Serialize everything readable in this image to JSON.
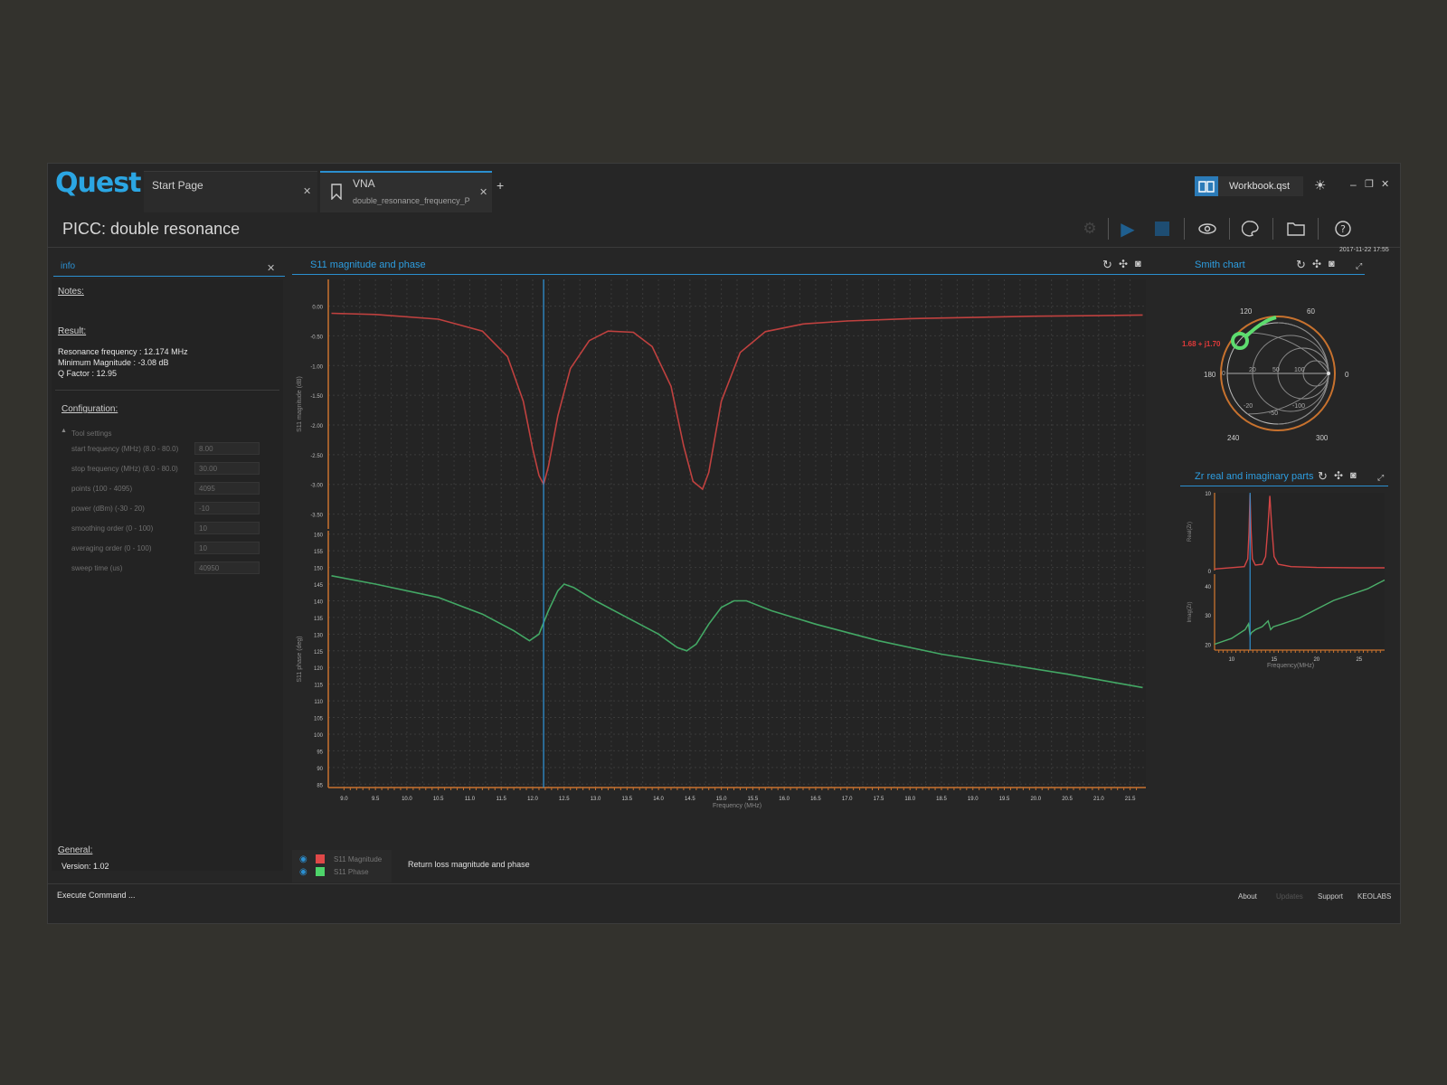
{
  "app": {
    "logo": "Quest"
  },
  "tabs": [
    {
      "label": "Start Page",
      "sub": ""
    },
    {
      "label": "VNA",
      "sub": "double_resonance_frequency_PI"
    }
  ],
  "tab_add": "+",
  "workbook": {
    "label": "Workbook.qst"
  },
  "page_title": "PICC: double resonance",
  "timestamp": "2017-11-22 17:55",
  "info_panel": {
    "search_value": "info",
    "notes_label": "Notes:",
    "result_label": "Result:",
    "result_lines": [
      "Resonance frequency : 12.174 MHz",
      "Minimum Magnitude : -3.08 dB",
      "Q Factor : 12.95"
    ],
    "config_label": "Configuration:",
    "tool_settings_label": "Tool settings",
    "settings": [
      {
        "label": "start frequency (MHz) (8.0 - 80.0)",
        "value": "8.00"
      },
      {
        "label": "stop frequency (MHz) (8.0 - 80.0)",
        "value": "30.00"
      },
      {
        "label": "points (100 - 4095)",
        "value": "4095"
      },
      {
        "label": "power (dBm) (-30 - 20)",
        "value": "-10"
      },
      {
        "label": "smoothing order (0 - 100)",
        "value": "10"
      },
      {
        "label": "averaging order (0 - 100)",
        "value": "10"
      },
      {
        "label": "sweep time (us)",
        "value": "40950"
      }
    ],
    "general_label": "General:",
    "version": "Version: 1.02"
  },
  "main_chart_title": "S11 magnitude and phase",
  "smith_title": "Smith chart",
  "smith_readout": "1.68 + j1.70",
  "smith_labels": [
    "120",
    "60",
    "180",
    "0",
    "240",
    "300",
    "20",
    "50",
    "100",
    "-20",
    "-50",
    "-100",
    "0"
  ],
  "zr_title": "Zr real and imaginary parts",
  "legend": {
    "items": [
      {
        "name": "S11 Magnitude",
        "color": "#e04848"
      },
      {
        "name": "S11 Phase",
        "color": "#4ed46a"
      }
    ],
    "description": "Return loss magnitude and phase"
  },
  "statusbar": {
    "command": "Execute Command ...",
    "links": [
      "About",
      "Updates",
      "Support",
      "KEOLABS"
    ]
  },
  "chart_data": [
    {
      "type": "line",
      "title": "S11 magnitude and phase",
      "xlabel": "Frequency (MHz)",
      "x_ticks": [
        "9.0",
        "9.5",
        "10.0",
        "10.5",
        "11.0",
        "11.5",
        "12.0",
        "12.5",
        "13.0",
        "13.5",
        "14.0",
        "14.5",
        "15.0",
        "15.5",
        "16.0",
        "16.5",
        "17.0",
        "17.5",
        "18.0",
        "18.5",
        "19.0",
        "19.5",
        "20.0",
        "20.5",
        "21.0",
        "21.5"
      ],
      "xlim": [
        8.75,
        21.75
      ],
      "cursor_x": 12.174,
      "panels": [
        {
          "ylabel": "S11 magnitude (dB)",
          "ylim": [
            -3.75,
            0.45
          ],
          "y_ticks": [
            "0.00",
            "-0.50",
            "-1.00",
            "-1.50",
            "-2.00",
            "-2.50",
            "-3.00",
            "-3.50"
          ],
          "series": [
            {
              "name": "S11 Magnitude",
              "color": "#c0413f",
              "x": [
                8.8,
                9.5,
                10.5,
                11.2,
                11.6,
                11.85,
                12.0,
                12.1,
                12.174,
                12.25,
                12.4,
                12.6,
                12.9,
                13.2,
                13.6,
                13.9,
                14.2,
                14.4,
                14.55,
                14.7,
                14.8,
                15.0,
                15.3,
                15.7,
                16.3,
                17.0,
                18.0,
                19.0,
                20.0,
                21.0,
                21.7
              ],
              "values": [
                -0.12,
                -0.14,
                -0.22,
                -0.42,
                -0.85,
                -1.6,
                -2.4,
                -2.85,
                -3.0,
                -2.7,
                -1.85,
                -1.05,
                -0.58,
                -0.42,
                -0.44,
                -0.68,
                -1.35,
                -2.35,
                -2.95,
                -3.08,
                -2.8,
                -1.6,
                -0.78,
                -0.43,
                -0.3,
                -0.25,
                -0.21,
                -0.19,
                -0.17,
                -0.16,
                -0.15
              ]
            }
          ]
        },
        {
          "ylabel": "S11 phase (deg)",
          "ylim": [
            84,
            161
          ],
          "y_ticks": [
            "160",
            "155",
            "150",
            "145",
            "140",
            "135",
            "130",
            "125",
            "120",
            "115",
            "110",
            "105",
            "100",
            "95",
            "90",
            "85"
          ],
          "series": [
            {
              "name": "S11 Phase",
              "color": "#43a865",
              "x": [
                8.8,
                9.5,
                10.5,
                11.2,
                11.7,
                11.95,
                12.1,
                12.25,
                12.4,
                12.5,
                12.65,
                13.0,
                13.5,
                14.0,
                14.3,
                14.45,
                14.6,
                14.8,
                15.0,
                15.2,
                15.4,
                15.8,
                16.5,
                17.5,
                18.5,
                19.5,
                20.5,
                21.7
              ],
              "values": [
                147.5,
                145,
                141,
                136,
                131,
                128,
                130,
                137,
                143,
                145,
                144,
                140,
                135,
                130,
                126,
                125,
                127,
                133,
                138,
                140,
                140,
                137,
                133,
                128,
                124,
                121,
                118,
                114
              ]
            }
          ]
        }
      ]
    },
    {
      "type": "line",
      "title": "Zr real and imaginary parts",
      "xlabel": "Frequency(MHz)",
      "x_ticks": [
        "10",
        "15",
        "20",
        "25"
      ],
      "xlim": [
        8,
        28
      ],
      "cursor_x": 12.174,
      "panels": [
        {
          "ylabel": "Real(Zr)",
          "y_ticks": [
            "10",
            "0"
          ],
          "ylim": [
            0,
            10
          ],
          "series": [
            {
              "name": "Real(Zr)",
              "color": "#d24545",
              "x": [
                8,
                11.5,
                11.9,
                12.05,
                12.174,
                12.3,
                12.45,
                12.8,
                13.6,
                14.0,
                14.3,
                14.5,
                14.7,
                15.0,
                15.5,
                17,
                20,
                25,
                28
              ],
              "values": [
                0.2,
                0.5,
                1.5,
                5,
                9.8,
                5,
                1.5,
                0.7,
                0.8,
                1.8,
                6,
                9.6,
                6,
                1.8,
                0.8,
                0.5,
                0.4,
                0.35,
                0.35
              ]
            }
          ]
        },
        {
          "ylabel": "Imag(Zr)",
          "y_ticks": [
            "40",
            "30",
            "20"
          ],
          "ylim": [
            18,
            44
          ],
          "series": [
            {
              "name": "Imag(Zr)",
              "color": "#4caf6a",
              "x": [
                8,
                10,
                11.6,
                12.0,
                12.174,
                12.35,
                12.8,
                13.6,
                14.3,
                14.6,
                14.9,
                16,
                18,
                20,
                22,
                24,
                26,
                28
              ],
              "values": [
                20,
                22,
                25,
                27,
                23,
                24,
                25,
                26,
                28,
                25,
                26,
                27,
                29,
                32,
                35,
                37,
                39,
                42
              ]
            }
          ]
        }
      ]
    }
  ]
}
